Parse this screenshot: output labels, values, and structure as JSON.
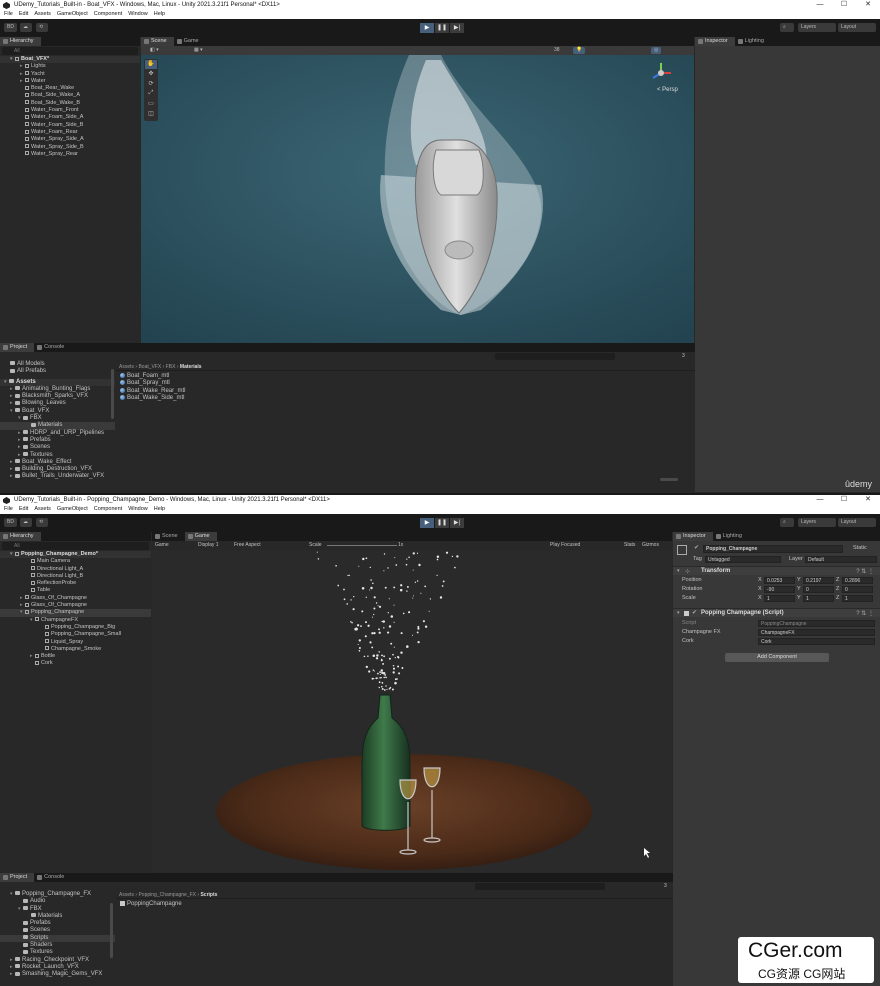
{
  "top": {
    "title": "UDemy_Tutorials_Built-in - Boat_VFX - Windows, Mac, Linux - Unity 2021.3.21f1 Personal* <DX11>",
    "menu": [
      "File",
      "Edit",
      "Assets",
      "GameObject",
      "Component",
      "Window",
      "Help"
    ],
    "toolbar": {
      "account": "BD",
      "layers": "Layers",
      "layout": "Layout",
      "scene_2d": "2D"
    },
    "tabs": {
      "hierarchy": "Hierarchy",
      "scene": "Scene",
      "game": "Game",
      "inspector": "Inspector",
      "lighting": "Lighting",
      "project": "Project",
      "console": "Console"
    },
    "hierarchy_search": "All",
    "hierarchy": [
      "Boat_VFX*",
      "Lights",
      "Yacht",
      "Water",
      "Boat_Rear_Wake",
      "Boat_Side_Wake_A",
      "Boat_Side_Wake_B",
      "Water_Foam_Front",
      "Water_Foam_Side_A",
      "Water_Foam_Side_B",
      "Water_Foam_Rear",
      "Water_Spray_Side_A",
      "Water_Spray_Side_B",
      "Water_Spray_Rear"
    ],
    "gizmo_label": "< Persp",
    "project_favorites": [
      "All Models",
      "All Prefabs"
    ],
    "project_tree": [
      "Assets",
      "Animating_Bunting_Flags",
      "Blacksmith_Sparks_VFX",
      "Blowing_Leaves",
      "Boat_VFX",
      "FBX",
      "Materials",
      "HDRP_and_URP_Pipelines",
      "Prefabs",
      "Scenes",
      "Textures",
      "Boat_Wake_Effect",
      "Building_Destruction_VFX",
      "Bullet_Trails_Underwater_VFX"
    ],
    "breadcrumb": [
      "Assets",
      "Boat_VFX",
      "FBX",
      "Materials"
    ],
    "files": [
      "Boat_Foam_mtl",
      "Boat_Spray_mtl",
      "Boat_Wake_Rear_mtl",
      "Boat_Wake_Side_mtl"
    ],
    "scene_count": "38",
    "badge_count": "3",
    "udemy": "ûdemy"
  },
  "bottom": {
    "title": "UDemy_Tutorials_Built-in - Popping_Champagne_Demo - Windows, Mac, Linux - Unity 2021.3.21f1 Personal* <DX11>",
    "hierarchy": [
      "Popping_Champagne_Demo*",
      "Main Camera",
      "Directional Light_A",
      "Directional Light_B",
      "ReflectionProbe",
      "Table",
      "Glass_Of_Champagne",
      "Glass_Of_Champagne",
      "Popping_Champagne",
      "ChampagneFX",
      "Popping_Champagne_Big",
      "Popping_Champagne_Small",
      "Liquid_Spray",
      "Champagne_Smoke",
      "Bottle",
      "Cork"
    ],
    "game_bar": {
      "mode": "Game",
      "display": "Display 1",
      "aspect": "Free Aspect",
      "scale_label": "Scale",
      "scale_value": "1x",
      "play_focused": "Play Focused",
      "stats": "Stats",
      "gizmos": "Gizmos"
    },
    "inspector": {
      "object_name": "Popping_Champagne",
      "static_label": "Static",
      "tag_label": "Tag",
      "tag_value": "Untagged",
      "layer_label": "Layer",
      "layer_value": "Default",
      "transform_title": "Transform",
      "position_label": "Position",
      "rotation_label": "Rotation",
      "scale_label": "Scale",
      "position": {
        "x": "0.0253",
        "y": "0.2197",
        "z": "0.2896"
      },
      "rotation": {
        "x": "-90",
        "y": "0",
        "z": "0"
      },
      "scale": {
        "x": "1",
        "y": "1",
        "z": "1"
      },
      "axis": {
        "x": "X",
        "y": "Y",
        "z": "Z"
      },
      "script_title": "Popping Champagne (Script)",
      "script_label": "Script",
      "script_value": "PoppingChampagne",
      "fx_label": "Champagne FX",
      "fx_value": "ChampagneFX",
      "cork_label": "Cork",
      "cork_value": "Cork",
      "add_component": "Add Component"
    },
    "project_tree": [
      "Popping_Champagne_FX",
      "Audio",
      "FBX",
      "Materials",
      "Prefabs",
      "Scenes",
      "Scripts",
      "Shaders",
      "Textures",
      "Racing_Checkpoint_VFX",
      "Rocket_Launch_VFX",
      "Smashing_Magic_Gems_VFX"
    ],
    "breadcrumb": [
      "Assets",
      "Popping_Champagne_FX",
      "Scripts"
    ],
    "files": [
      "PoppingChampagne"
    ]
  },
  "watermark": {
    "line1": "CGer.com",
    "line2": "CG资源 CG网站"
  }
}
